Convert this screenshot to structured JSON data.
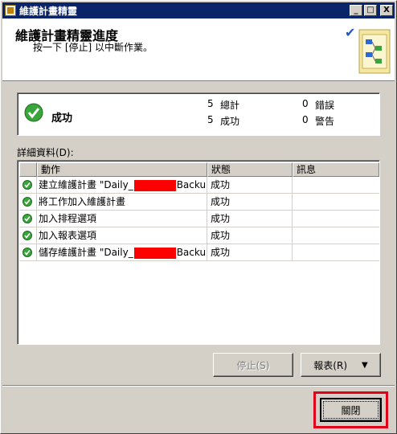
{
  "window": {
    "title": "維護計畫精靈",
    "controls": {
      "minimize": "_",
      "maximize": "□",
      "close": "X"
    }
  },
  "header": {
    "title": "維護計畫精靈進度",
    "subtitle": "按一下 [停止] 以中斷作業。"
  },
  "summary": {
    "status": "成功",
    "total_count": "5",
    "total_label": "總計",
    "success_count": "5",
    "success_label": "成功",
    "error_count": "0",
    "error_label": "錯誤",
    "warning_count": "0",
    "warning_label": "警告"
  },
  "details": {
    "label": "詳細資料(D):",
    "columns": [
      "動作",
      "狀態",
      "訊息"
    ],
    "rows": [
      {
        "action_prefix": "建立維護計畫 \"Daily_",
        "action_suffix": "Backu...",
        "redacted": true,
        "status": "成功",
        "message": ""
      },
      {
        "action_prefix": "將工作加入維護計畫",
        "action_suffix": "",
        "redacted": false,
        "status": "成功",
        "message": ""
      },
      {
        "action_prefix": "加入排程選項",
        "action_suffix": "",
        "redacted": false,
        "status": "成功",
        "message": ""
      },
      {
        "action_prefix": "加入報表選項",
        "action_suffix": "",
        "redacted": false,
        "status": "成功",
        "message": ""
      },
      {
        "action_prefix": "儲存維護計畫 \"Daily_",
        "action_suffix": "Backu...",
        "redacted": true,
        "status": "成功",
        "message": ""
      }
    ]
  },
  "buttons": {
    "stop": "停止(S)",
    "report": "報表(R)",
    "report_arrow": "▼",
    "close": "關閉"
  },
  "colors": {
    "title_bar": "#0a246a",
    "success_green": "#3aa53a",
    "highlight_red": "#e0001a"
  }
}
